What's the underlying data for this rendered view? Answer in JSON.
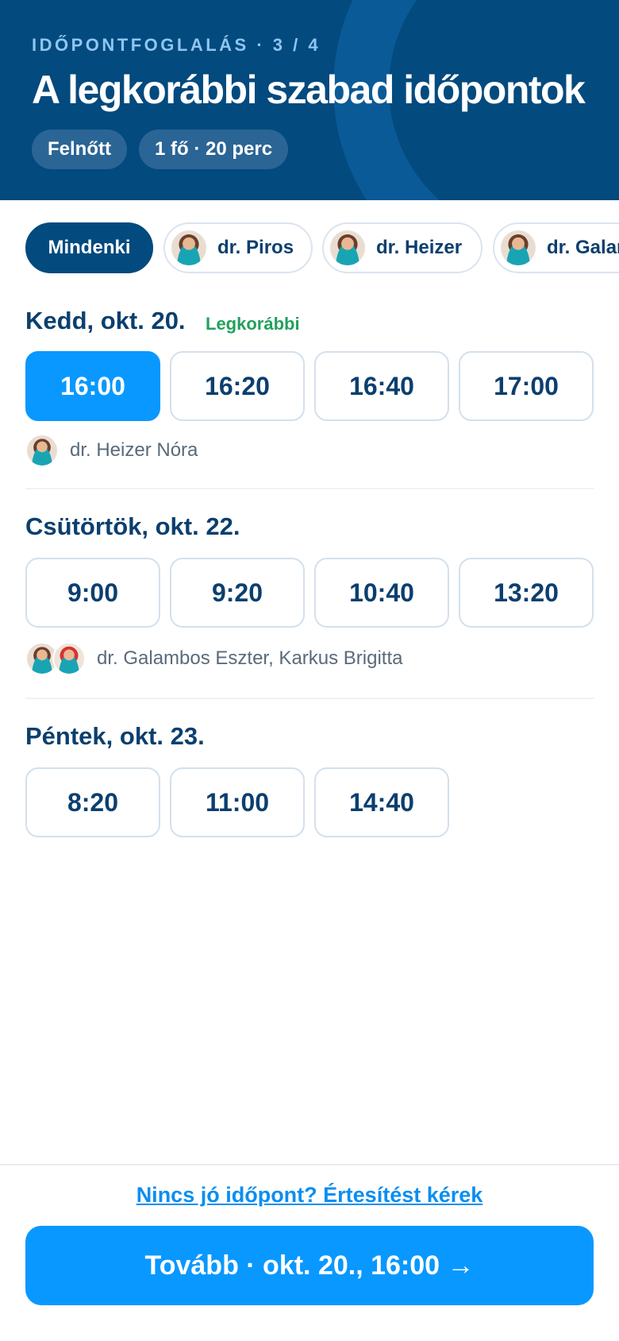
{
  "header": {
    "step": "IDŐPONTFOGLALÁS · 3 / 4",
    "title": "A legkorábbi szabad időpontok",
    "pills": [
      "Felnőtt",
      "1 fő · 20 perc"
    ]
  },
  "filters": {
    "all_label": "Mindenki",
    "doctors": [
      "dr. Piros",
      "dr. Heizer",
      "dr. Galambos"
    ]
  },
  "days": [
    {
      "title": "Kedd, okt. 20.",
      "badge": "Legkorábbi",
      "slots": [
        "16:00",
        "16:20",
        "16:40",
        "17:00"
      ],
      "selected_slot": "16:00",
      "doctors_text": "dr. Heizer Nóra"
    },
    {
      "title": "Csütörtök, okt. 22.",
      "slots": [
        "9:00",
        "9:20",
        "10:40",
        "13:20"
      ],
      "doctors_text": "dr. Galambos Eszter, Karkus Brigitta"
    },
    {
      "title": "Péntek, okt. 23.",
      "slots": [
        "8:20",
        "11:00",
        "14:40"
      ]
    }
  ],
  "footer": {
    "notify_link": "Nincs jó időpont? Értesítést kérek",
    "next_button": "Tovább · okt. 20., 16:00 →"
  },
  "colors": {
    "header_bg": "#034a7e",
    "accent": "#0998ff",
    "badge_green": "#23a05e",
    "text_dark": "#0b3f6e"
  },
  "icons": [
    "doctor-avatar"
  ]
}
